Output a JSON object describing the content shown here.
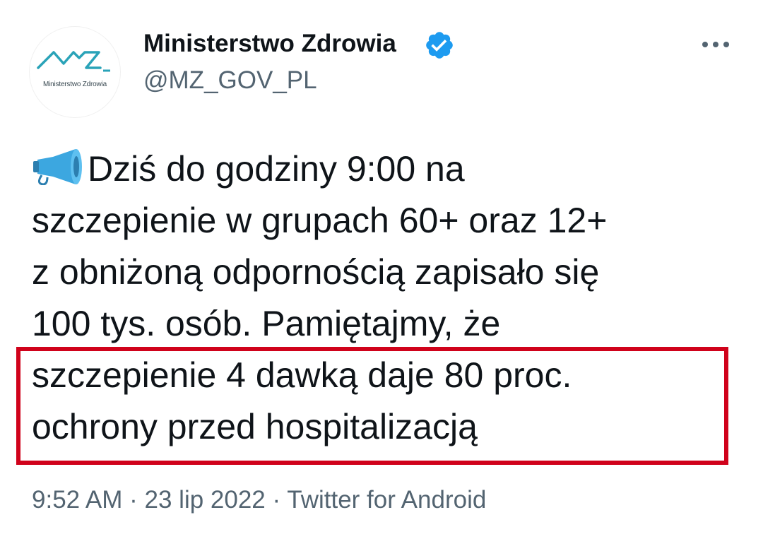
{
  "account": {
    "logo_label": "Ministerstwo Zdrowia",
    "display_name": "Ministerstwo Zdrowia",
    "handle": "@MZ_GOV_PL",
    "verified": true
  },
  "tweet": {
    "lines": [
      "Dziś do godziny 9:00 na",
      "szczepienie w grupach 60+ oraz 12+",
      "z obniżoną odpornością zapisało się",
      "100 tys. osób. Pamiętajmy, że",
      "szczepienie 4 dawką daje 80 proc.",
      "ochrony przed hospitalizacją"
    ],
    "leading_icon": "megaphone-icon",
    "highlighted_lines": [
      5,
      6
    ]
  },
  "meta": {
    "text": "9:52 AM · 23 lip 2022 · Twitter for Android"
  },
  "colors": {
    "text": "#0f1419",
    "secondary": "#536471",
    "verified": "#1d9bf0",
    "highlight_border": "#d0021b",
    "logo": "#2aa3b8"
  },
  "icons": {
    "verified": "verified-badge-icon",
    "more": "more-options-icon"
  }
}
